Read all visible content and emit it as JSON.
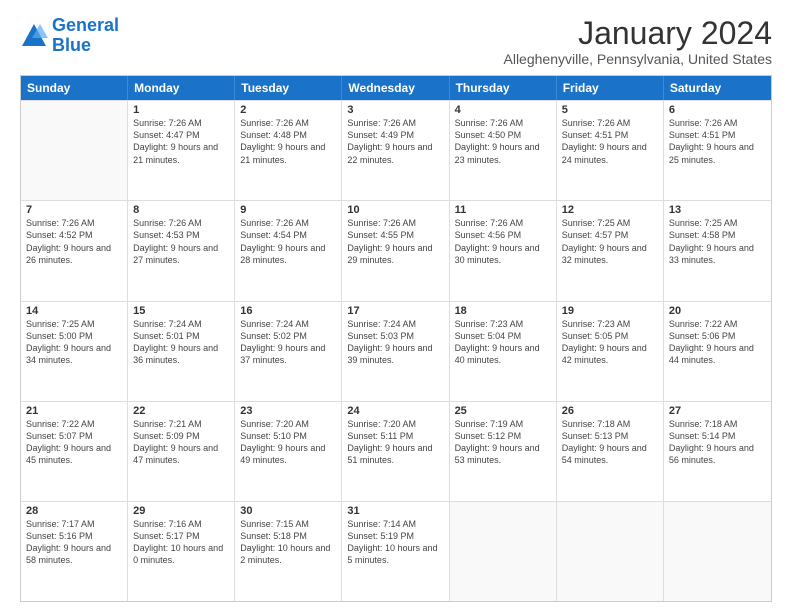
{
  "logo": {
    "line1": "General",
    "line2": "Blue"
  },
  "title": "January 2024",
  "subtitle": "Alleghenyville, Pennsylvania, United States",
  "days_of_week": [
    "Sunday",
    "Monday",
    "Tuesday",
    "Wednesday",
    "Thursday",
    "Friday",
    "Saturday"
  ],
  "weeks": [
    [
      {
        "num": "",
        "sunrise": "",
        "sunset": "",
        "daylight": ""
      },
      {
        "num": "1",
        "sunrise": "Sunrise: 7:26 AM",
        "sunset": "Sunset: 4:47 PM",
        "daylight": "Daylight: 9 hours and 21 minutes."
      },
      {
        "num": "2",
        "sunrise": "Sunrise: 7:26 AM",
        "sunset": "Sunset: 4:48 PM",
        "daylight": "Daylight: 9 hours and 21 minutes."
      },
      {
        "num": "3",
        "sunrise": "Sunrise: 7:26 AM",
        "sunset": "Sunset: 4:49 PM",
        "daylight": "Daylight: 9 hours and 22 minutes."
      },
      {
        "num": "4",
        "sunrise": "Sunrise: 7:26 AM",
        "sunset": "Sunset: 4:50 PM",
        "daylight": "Daylight: 9 hours and 23 minutes."
      },
      {
        "num": "5",
        "sunrise": "Sunrise: 7:26 AM",
        "sunset": "Sunset: 4:51 PM",
        "daylight": "Daylight: 9 hours and 24 minutes."
      },
      {
        "num": "6",
        "sunrise": "Sunrise: 7:26 AM",
        "sunset": "Sunset: 4:51 PM",
        "daylight": "Daylight: 9 hours and 25 minutes."
      }
    ],
    [
      {
        "num": "7",
        "sunrise": "Sunrise: 7:26 AM",
        "sunset": "Sunset: 4:52 PM",
        "daylight": "Daylight: 9 hours and 26 minutes."
      },
      {
        "num": "8",
        "sunrise": "Sunrise: 7:26 AM",
        "sunset": "Sunset: 4:53 PM",
        "daylight": "Daylight: 9 hours and 27 minutes."
      },
      {
        "num": "9",
        "sunrise": "Sunrise: 7:26 AM",
        "sunset": "Sunset: 4:54 PM",
        "daylight": "Daylight: 9 hours and 28 minutes."
      },
      {
        "num": "10",
        "sunrise": "Sunrise: 7:26 AM",
        "sunset": "Sunset: 4:55 PM",
        "daylight": "Daylight: 9 hours and 29 minutes."
      },
      {
        "num": "11",
        "sunrise": "Sunrise: 7:26 AM",
        "sunset": "Sunset: 4:56 PM",
        "daylight": "Daylight: 9 hours and 30 minutes."
      },
      {
        "num": "12",
        "sunrise": "Sunrise: 7:25 AM",
        "sunset": "Sunset: 4:57 PM",
        "daylight": "Daylight: 9 hours and 32 minutes."
      },
      {
        "num": "13",
        "sunrise": "Sunrise: 7:25 AM",
        "sunset": "Sunset: 4:58 PM",
        "daylight": "Daylight: 9 hours and 33 minutes."
      }
    ],
    [
      {
        "num": "14",
        "sunrise": "Sunrise: 7:25 AM",
        "sunset": "Sunset: 5:00 PM",
        "daylight": "Daylight: 9 hours and 34 minutes."
      },
      {
        "num": "15",
        "sunrise": "Sunrise: 7:24 AM",
        "sunset": "Sunset: 5:01 PM",
        "daylight": "Daylight: 9 hours and 36 minutes."
      },
      {
        "num": "16",
        "sunrise": "Sunrise: 7:24 AM",
        "sunset": "Sunset: 5:02 PM",
        "daylight": "Daylight: 9 hours and 37 minutes."
      },
      {
        "num": "17",
        "sunrise": "Sunrise: 7:24 AM",
        "sunset": "Sunset: 5:03 PM",
        "daylight": "Daylight: 9 hours and 39 minutes."
      },
      {
        "num": "18",
        "sunrise": "Sunrise: 7:23 AM",
        "sunset": "Sunset: 5:04 PM",
        "daylight": "Daylight: 9 hours and 40 minutes."
      },
      {
        "num": "19",
        "sunrise": "Sunrise: 7:23 AM",
        "sunset": "Sunset: 5:05 PM",
        "daylight": "Daylight: 9 hours and 42 minutes."
      },
      {
        "num": "20",
        "sunrise": "Sunrise: 7:22 AM",
        "sunset": "Sunset: 5:06 PM",
        "daylight": "Daylight: 9 hours and 44 minutes."
      }
    ],
    [
      {
        "num": "21",
        "sunrise": "Sunrise: 7:22 AM",
        "sunset": "Sunset: 5:07 PM",
        "daylight": "Daylight: 9 hours and 45 minutes."
      },
      {
        "num": "22",
        "sunrise": "Sunrise: 7:21 AM",
        "sunset": "Sunset: 5:09 PM",
        "daylight": "Daylight: 9 hours and 47 minutes."
      },
      {
        "num": "23",
        "sunrise": "Sunrise: 7:20 AM",
        "sunset": "Sunset: 5:10 PM",
        "daylight": "Daylight: 9 hours and 49 minutes."
      },
      {
        "num": "24",
        "sunrise": "Sunrise: 7:20 AM",
        "sunset": "Sunset: 5:11 PM",
        "daylight": "Daylight: 9 hours and 51 minutes."
      },
      {
        "num": "25",
        "sunrise": "Sunrise: 7:19 AM",
        "sunset": "Sunset: 5:12 PM",
        "daylight": "Daylight: 9 hours and 53 minutes."
      },
      {
        "num": "26",
        "sunrise": "Sunrise: 7:18 AM",
        "sunset": "Sunset: 5:13 PM",
        "daylight": "Daylight: 9 hours and 54 minutes."
      },
      {
        "num": "27",
        "sunrise": "Sunrise: 7:18 AM",
        "sunset": "Sunset: 5:14 PM",
        "daylight": "Daylight: 9 hours and 56 minutes."
      }
    ],
    [
      {
        "num": "28",
        "sunrise": "Sunrise: 7:17 AM",
        "sunset": "Sunset: 5:16 PM",
        "daylight": "Daylight: 9 hours and 58 minutes."
      },
      {
        "num": "29",
        "sunrise": "Sunrise: 7:16 AM",
        "sunset": "Sunset: 5:17 PM",
        "daylight": "Daylight: 10 hours and 0 minutes."
      },
      {
        "num": "30",
        "sunrise": "Sunrise: 7:15 AM",
        "sunset": "Sunset: 5:18 PM",
        "daylight": "Daylight: 10 hours and 2 minutes."
      },
      {
        "num": "31",
        "sunrise": "Sunrise: 7:14 AM",
        "sunset": "Sunset: 5:19 PM",
        "daylight": "Daylight: 10 hours and 5 minutes."
      },
      {
        "num": "",
        "sunrise": "",
        "sunset": "",
        "daylight": ""
      },
      {
        "num": "",
        "sunrise": "",
        "sunset": "",
        "daylight": ""
      },
      {
        "num": "",
        "sunrise": "",
        "sunset": "",
        "daylight": ""
      }
    ]
  ]
}
